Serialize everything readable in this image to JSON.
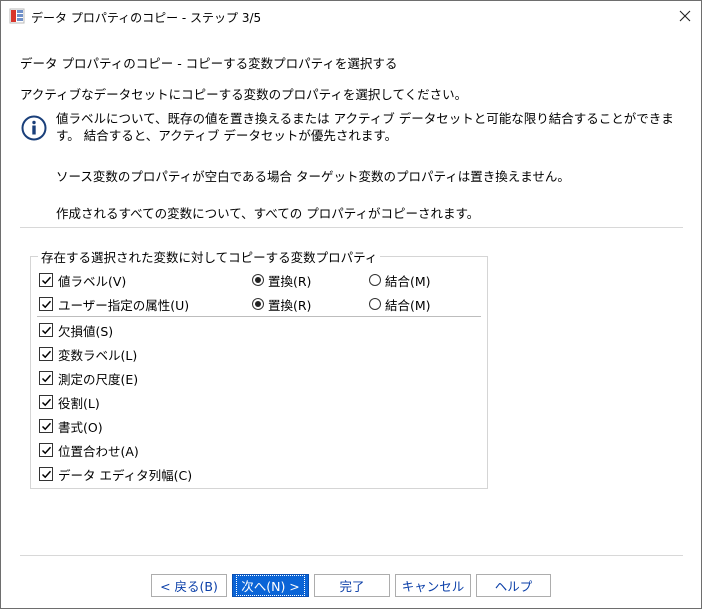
{
  "window": {
    "title": "データ プロパティのコピー - ステップ 3/5"
  },
  "header": {
    "heading": "データ プロパティのコピー - コピーする変数プロパティを選択する",
    "instruction": "アクティブなデータセットにコピーする変数のプロパティを選択してください。"
  },
  "info": {
    "paragraph1": "値ラベルについて、既存の値を置き換えるまたは アクティブ データセットと可能な限り結合することができます。 結合すると、アクティブ データセットが優先されます。",
    "paragraph2": "ソース変数のプロパティが空白である場合 ターゲット変数のプロパティは置き換えません。",
    "paragraph3": "作成されるすべての変数について、すべての プロパティがコピーされます。"
  },
  "group": {
    "legend": "存在する選択された変数に対してコピーする変数プロパティ",
    "radio_items": [
      {
        "label": "値ラベル(V)",
        "checked": true,
        "replace_label": "置換(R)",
        "merge_label": "結合(M)",
        "selected": "replace"
      },
      {
        "label": "ユーザー指定の属性(U)",
        "checked": true,
        "replace_label": "置換(R)",
        "merge_label": "結合(M)",
        "selected": "replace"
      }
    ],
    "items": [
      {
        "label": "欠損値(S)",
        "checked": true
      },
      {
        "label": "変数ラベル(L)",
        "checked": true
      },
      {
        "label": "測定の尺度(E)",
        "checked": true
      },
      {
        "label": "役割(L)",
        "checked": true
      },
      {
        "label": "書式(O)",
        "checked": true
      },
      {
        "label": "位置合わせ(A)",
        "checked": true
      },
      {
        "label": "データ エディタ列幅(C)",
        "checked": true
      }
    ]
  },
  "buttons": {
    "back": "< 戻る(B)",
    "next": "次へ(N) >",
    "finish": "完了",
    "cancel": "キャンセル",
    "help": "ヘルプ"
  },
  "icons": {
    "app": "spss-dialog-icon",
    "info": "info-icon",
    "close": "close-icon"
  },
  "colors": {
    "primary_button": "#0a64d6",
    "button_text": "#0b3fa8"
  }
}
